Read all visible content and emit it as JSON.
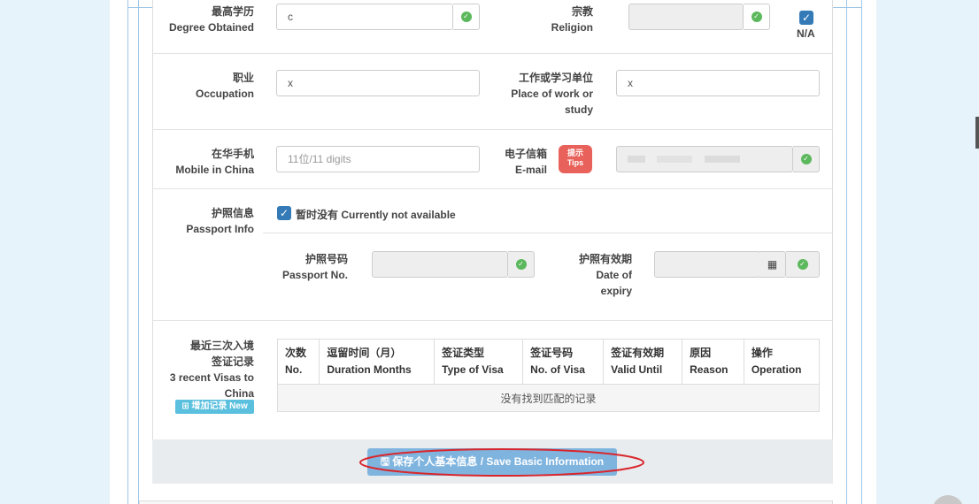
{
  "form": {
    "degree": {
      "cn": "最高学历",
      "en": "Degree Obtained",
      "value": "c"
    },
    "religion": {
      "cn": "宗教",
      "en": "Religion",
      "value": "",
      "na_label": "N/A",
      "na_checked": true
    },
    "occupation": {
      "cn": "职业",
      "en": "Occupation",
      "value": "x"
    },
    "workplace": {
      "cn": "工作或学习单位",
      "en1": "Place of work or",
      "en2": "study",
      "value": "x"
    },
    "mobile": {
      "cn": "在华手机",
      "en": "Mobile in China",
      "placeholder": "11位/11 digits"
    },
    "email": {
      "cn": "电子信箱",
      "en": "E-mail",
      "tips_cn": "提示",
      "tips_en": "Tips",
      "value": ""
    },
    "passport": {
      "cn": "护照信息",
      "en": "Passport Info",
      "not_available_label": "暂时没有  Currently not available",
      "not_available_checked": true,
      "number": {
        "cn": "护照号码",
        "en": "Passport No."
      },
      "expiry": {
        "cn": "护照有效期",
        "en1": "Date of",
        "en2": "expiry"
      }
    },
    "visas": {
      "cn1": "最近三次入境",
      "cn2": "签证记录",
      "en1": "3 recent Visas to",
      "en2": "China",
      "add_button": "⊞ 增加记录 New",
      "columns": [
        {
          "cn": "次数",
          "en": "No."
        },
        {
          "cn": "逗留时间（月）",
          "en": "Duration Months"
        },
        {
          "cn": "签证类型",
          "en": "Type of Visa"
        },
        {
          "cn": "签证号码",
          "en": "No. of Visa"
        },
        {
          "cn": "签证有效期",
          "en": "Valid Until"
        },
        {
          "cn": "原因",
          "en": "Reason"
        },
        {
          "cn": "操作",
          "en": "Operation"
        }
      ],
      "empty_text": "没有找到匹配的记录"
    },
    "save_button": "🖫 保存个人基本信息 / Save Basic Information"
  },
  "colors": {
    "page_bg": "#e6f3fb",
    "primary": "#337ab7",
    "success": "#5cb85c",
    "save_button": "#7fb4df",
    "tips": "#e8625b",
    "annotation": "#d9262c"
  }
}
